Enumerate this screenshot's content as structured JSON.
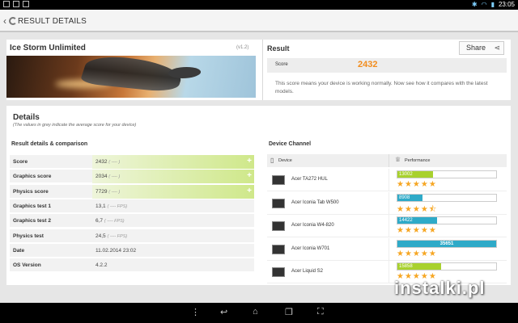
{
  "status": {
    "time": "23:05"
  },
  "actionbar": {
    "title": "RESULT DETAILS"
  },
  "hero": {
    "title": "Ice Storm Unlimited",
    "version": "(v1.2)"
  },
  "result": {
    "title": "Result",
    "share_label": "Share",
    "score_label": "Score",
    "score_value": "2432",
    "description": "This score means your device is working normally. Now see how it compares with the latest models."
  },
  "details": {
    "title": "Details",
    "subtitle": "(The values in grey indicate the average score for your device)",
    "left_heading": "Result details & comparison",
    "right_heading": "Device Channel",
    "rows": [
      {
        "label": "Score",
        "value": "2432",
        "avg": "( ---- )"
      },
      {
        "label": "Graphics score",
        "value": "2034",
        "avg": "( ---- )"
      },
      {
        "label": "Physics score",
        "value": "7729",
        "avg": "( ---- )"
      },
      {
        "label": "Graphics test 1",
        "value": "13,1",
        "avg": "( ---- FPS)"
      },
      {
        "label": "Graphics test 2",
        "value": "6,7",
        "avg": "( ---- FPS)"
      },
      {
        "label": "Physics test",
        "value": "24,5",
        "avg": "( ---- FPS)"
      },
      {
        "label": "Date",
        "value": "11.02.2014 23:02",
        "avg": ""
      },
      {
        "label": "OS Version",
        "value": "4.2.2",
        "avg": ""
      }
    ]
  },
  "devices": {
    "col_device": "Device",
    "col_performance": "Performance",
    "items": [
      {
        "name": "Acer TA272 HUL",
        "score": "13002",
        "fraction": 0.36,
        "color": "#a8d12e",
        "stars": 5
      },
      {
        "name": "Acer Iconia Tab W500",
        "score": "8908",
        "fraction": 0.25,
        "color": "#2eaac8",
        "stars": 4.5
      },
      {
        "name": "Acer Iconia W4-820",
        "score": "14422",
        "fraction": 0.4,
        "color": "#2eaac8",
        "stars": 5
      },
      {
        "name": "Acer Iconia W701",
        "score": "35651",
        "fraction": 1.0,
        "color": "#2eaac8",
        "stars": 5
      },
      {
        "name": "Acer Liquid S2",
        "score": "15858",
        "fraction": 0.44,
        "color": "#a8d12e",
        "stars": 5
      }
    ]
  },
  "watermark": {
    "text": "instalki.pl"
  }
}
